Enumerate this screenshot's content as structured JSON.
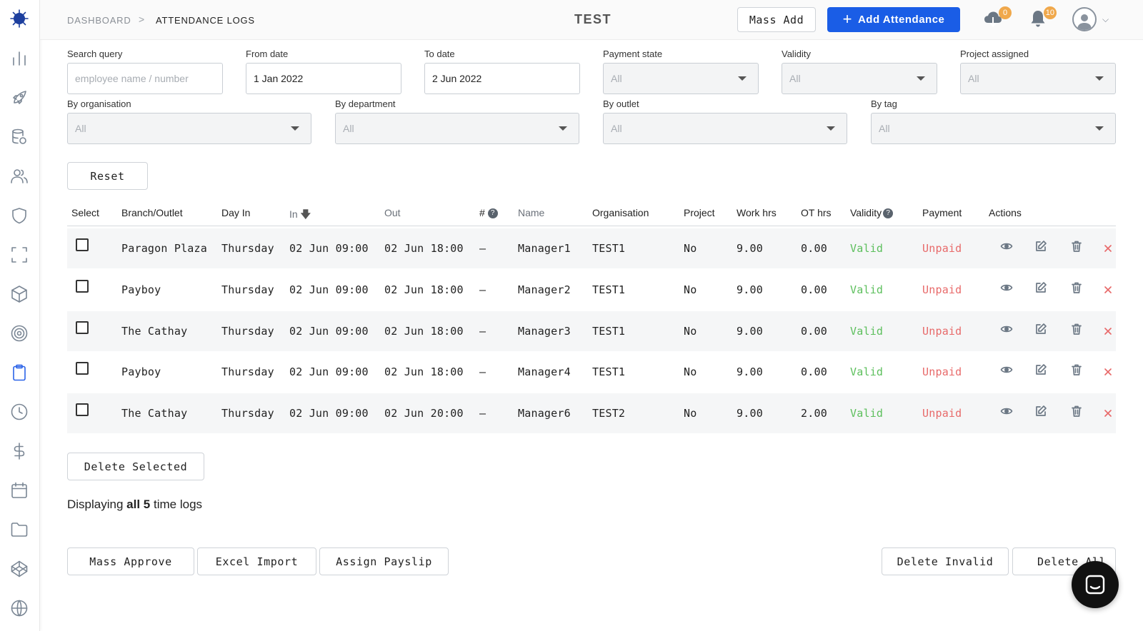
{
  "sidebar": {
    "items": [
      {
        "name": "logo-icon"
      },
      {
        "name": "chart-icon"
      },
      {
        "name": "rocket-icon"
      },
      {
        "name": "database-icon"
      },
      {
        "name": "users-icon"
      },
      {
        "name": "shield-icon"
      },
      {
        "name": "scan-icon"
      },
      {
        "name": "cube-icon"
      },
      {
        "name": "target-icon"
      },
      {
        "name": "clipboard-icon",
        "active": true
      },
      {
        "name": "clock-icon"
      },
      {
        "name": "dollar-icon"
      },
      {
        "name": "calendar-icon"
      },
      {
        "name": "folder-icon"
      },
      {
        "name": "codepen-icon"
      },
      {
        "name": "globe-icon"
      }
    ],
    "accent_color": "#2b63e8"
  },
  "header": {
    "breadcrumb": [
      "DASHBOARD",
      "ATTENDANCE LOGS"
    ],
    "breadcrumb_sep": ">",
    "title": "TEST",
    "mass_add_label": "Mass Add",
    "add_attendance_label": "Add Attendance",
    "cloud_badge": "0",
    "bell_badge": "10",
    "primary_color": "#1a5de6"
  },
  "filters": {
    "search_label": "Search query",
    "search_placeholder": "employee name / number",
    "from_label": "From date",
    "from_value": "1 Jan 2022",
    "to_label": "To date",
    "to_value": "2 Jun 2022",
    "payment_label": "Payment state",
    "payment_value": "All",
    "validity_label": "Validity",
    "validity_value": "All",
    "project_label": "Project assigned",
    "project_value": "All",
    "org_label": "By organisation",
    "org_value": "All",
    "dept_label": "By department",
    "dept_value": "All",
    "outlet_label": "By outlet",
    "outlet_value": "All",
    "tag_label": "By tag",
    "tag_value": "All",
    "reset_label": "Reset"
  },
  "table": {
    "headers": {
      "select": "Select",
      "branch": "Branch/Outlet",
      "day_in": "Day In",
      "in": "In",
      "out": "Out",
      "hash": "#",
      "name": "Name",
      "org": "Organisation",
      "project": "Project",
      "work": "Work hrs",
      "ot": "OT hrs",
      "validity": "Validity",
      "payment": "Payment",
      "actions": "Actions"
    },
    "rows": [
      {
        "branch": "Paragon Plaza",
        "day": "Thursday",
        "in": "02 Jun 09:00",
        "out": "02 Jun 18:00",
        "hash": "—",
        "name": "Manager1",
        "org": "TEST1",
        "project": "No",
        "work": "9.00",
        "ot": "0.00",
        "validity": "Valid",
        "payment": "Unpaid"
      },
      {
        "branch": "Payboy",
        "day": "Thursday",
        "in": "02 Jun 09:00",
        "out": "02 Jun 18:00",
        "hash": "—",
        "name": "Manager2",
        "org": "TEST1",
        "project": "No",
        "work": "9.00",
        "ot": "0.00",
        "validity": "Valid",
        "payment": "Unpaid"
      },
      {
        "branch": "The Cathay",
        "day": "Thursday",
        "in": "02 Jun 09:00",
        "out": "02 Jun 18:00",
        "hash": "—",
        "name": "Manager3",
        "org": "TEST1",
        "project": "No",
        "work": "9.00",
        "ot": "0.00",
        "validity": "Valid",
        "payment": "Unpaid"
      },
      {
        "branch": "Payboy",
        "day": "Thursday",
        "in": "02 Jun 09:00",
        "out": "02 Jun 18:00",
        "hash": "—",
        "name": "Manager4",
        "org": "TEST1",
        "project": "No",
        "work": "9.00",
        "ot": "0.00",
        "validity": "Valid",
        "payment": "Unpaid"
      },
      {
        "branch": "The Cathay",
        "day": "Thursday",
        "in": "02 Jun 09:00",
        "out": "02 Jun 20:00",
        "hash": "—",
        "name": "Manager6",
        "org": "TEST2",
        "project": "No",
        "work": "9.00",
        "ot": "2.00",
        "validity": "Valid",
        "payment": "Unpaid"
      }
    ],
    "valid_color": "#5cbf5c",
    "unpaid_color": "#e86a6a"
  },
  "footer": {
    "delete_selected_label": "Delete Selected",
    "summary_prefix": "Displaying",
    "summary_bold": "all 5",
    "summary_suffix": "time logs",
    "mass_approve_label": "Mass Approve",
    "excel_import_label": "Excel Import",
    "assign_payslip_label": "Assign Payslip",
    "delete_invalid_label": "Delete Invalid",
    "delete_all_label": "Delete All"
  }
}
